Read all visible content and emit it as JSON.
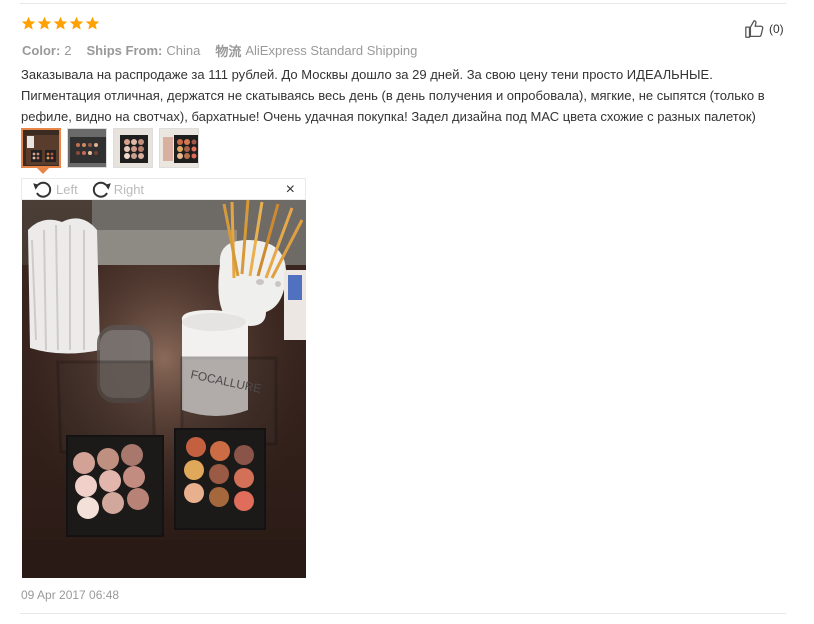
{
  "review": {
    "rating": 5,
    "color_label": "Color:",
    "color_value": "2",
    "ships_label": "Ships From:",
    "ships_value": "China",
    "logistics_label": "物流",
    "logistics_value": "AliExpress Standard Shipping",
    "text": "Заказывала на распродаже за 111 рублей. До Москвы дошло за 29 дней. За свою цену тени просто ИДЕАЛЬНЫЕ. Пигментация отличная, держатся не скатываясь весь день (в день получения и опробовала), мягкие, не сыпятся (только в рефиле, видно на свотчах), бархатные! Очень удачная покупка! Задел дизайна под МАС цвета схожие с разных палеток)",
    "like_count": "(0)",
    "date": "09 Apr 2017 06:48"
  },
  "viewer": {
    "rotate_left_label": "Left",
    "rotate_right_label": "Right",
    "close_glyph": "×",
    "photo_caption_text": "FOCALLURE"
  },
  "colors": {
    "star": "#ffa200",
    "accent": "#e8864a",
    "muted": "#999999"
  },
  "icons": [
    "star-icon",
    "thumbs-up-icon",
    "rotate-left-icon",
    "rotate-right-icon",
    "close-icon"
  ]
}
